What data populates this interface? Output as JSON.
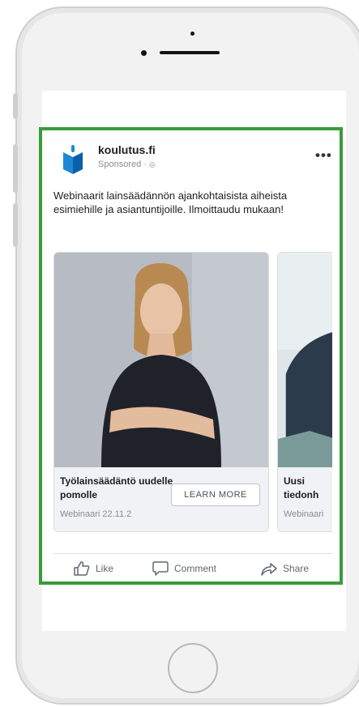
{
  "ad": {
    "brand": "koulutus.fi",
    "sponsored": "Sponsored · ",
    "more": "•••",
    "text": "Webinaarit lainsäädännön ajankohtaisista aiheista esimiehille ja asiantuntijoille. Ilmoittaudu mukaan!"
  },
  "carousel": {
    "items": [
      {
        "title": "Työlainsäädäntö uudelle pomolle",
        "meta": "Webinaari 22.11.2",
        "cta": "LEARN MORE"
      },
      {
        "title": "Uusi tiedonh",
        "meta": "Webinaari"
      }
    ]
  },
  "actions": {
    "like": "Like",
    "comment": "Comment",
    "share": "Share"
  },
  "colors": {
    "frame_border": "#3a9c3a",
    "brand_blue": "#1877f2",
    "photo_bg": "#b7bcc4"
  }
}
